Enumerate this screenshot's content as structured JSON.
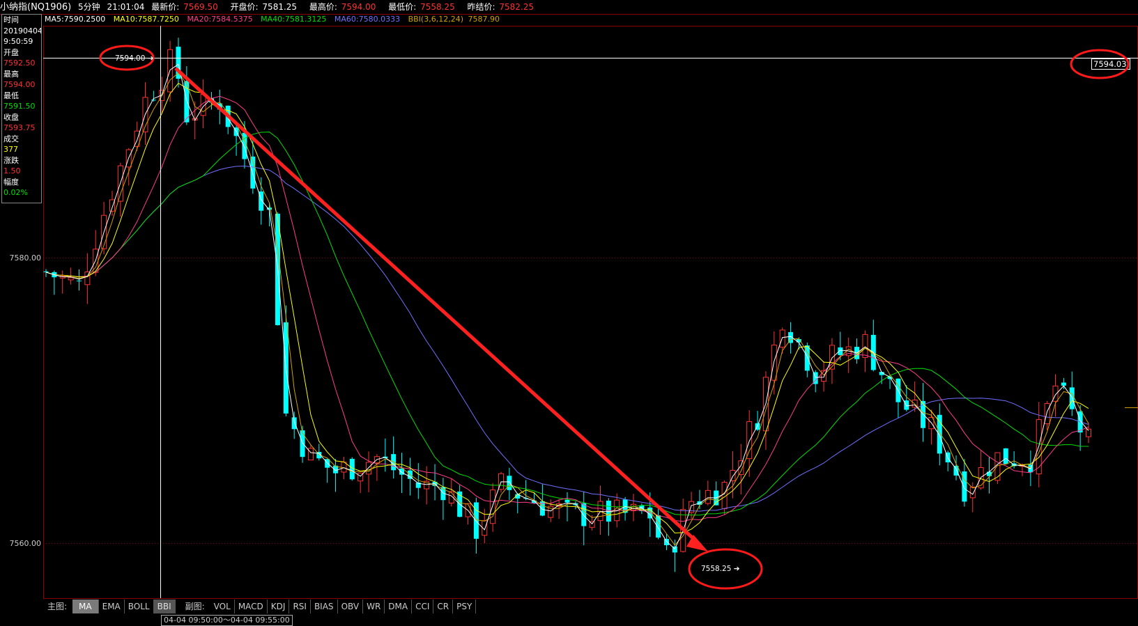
{
  "header": {
    "title": "小纳指(NQ1906)",
    "period": "5分钟",
    "time": "21:01:04",
    "latest_label": "最新价:",
    "latest_value": "7569.50",
    "open_label": "开盘价:",
    "open_value": "7581.25",
    "high_label": "最高价:",
    "high_value": "7594.00",
    "low_label": "最低价:",
    "low_value": "7558.25",
    "prev_label": "昨结价:",
    "prev_value": "7582.25"
  },
  "legend": {
    "ma5": "MA5:7590.2500",
    "ma10": "MA10:7587.7250",
    "ma20": "MA20:7584.5375",
    "ma40": "MA40:7581.3125",
    "ma60": "MA60:7580.0333",
    "bbi": "BBI(3,6,12,24)",
    "bbi_value": "7587.90"
  },
  "infobox": {
    "time_label": "时间",
    "date": "20190404",
    "time": "9:50:59",
    "open_label": "开盘",
    "open": "7592.50",
    "high_label": "最高",
    "high": "7594.00",
    "low_label": "最低",
    "low": "7591.50",
    "close_label": "收盘",
    "close": "7593.75",
    "volume_label": "成交",
    "volume": "377",
    "change_label": "涨跌",
    "change": "1.50",
    "amplitude_label": "幅度",
    "amplitude": "0.02%"
  },
  "axis": {
    "y_labels": [
      "7580.00",
      "7560.00"
    ],
    "crosshair_value": "7594.03"
  },
  "annotations": {
    "high_marker": "7594.00",
    "low_marker": "7558.25"
  },
  "tabs": {
    "main_label": "主图:",
    "main": [
      "MA",
      "EMA",
      "BOLL",
      "BBI"
    ],
    "main_active": "MA",
    "sub_label": "副图:",
    "sub": [
      "VOL",
      "MACD",
      "KDJ",
      "RSI",
      "BIAS",
      "OBV",
      "WR",
      "DMA",
      "CCI",
      "CR",
      "PSY"
    ]
  },
  "status": {
    "range": "04-04  09:50:00～04-04 09:55:00"
  },
  "colors": {
    "up": "#ff3232",
    "down": "#00ffff",
    "ma5": "#ffffff",
    "ma10": "#ffff00",
    "ma20": "#ff3c8c",
    "ma40": "#00e000",
    "ma60": "#7070ff",
    "bbi": "#d2a000",
    "annotation": "#ff0000"
  }
}
